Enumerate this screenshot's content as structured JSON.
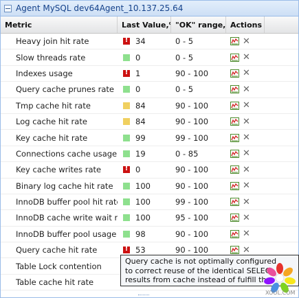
{
  "panel": {
    "title": "Agent MySQL dev64Agent_10.137.25.64"
  },
  "columns": {
    "metric": "Metric",
    "last_value": "Last Value,%",
    "ok_range": "\"OK\" range,%",
    "actions": "Actions"
  },
  "rows": [
    {
      "metric": "Heavy join hit rate",
      "status": "critical",
      "value": "34",
      "range": "0 - 5"
    },
    {
      "metric": "Slow threads rate",
      "status": "ok",
      "value": "0",
      "range": "0 - 5"
    },
    {
      "metric": "Indexes usage",
      "status": "critical",
      "value": "1",
      "range": "90 - 100"
    },
    {
      "metric": "Query cache prunes rate",
      "status": "ok",
      "value": "0",
      "range": "0 - 5"
    },
    {
      "metric": "Tmp cache hit rate",
      "status": "warning",
      "value": "84",
      "range": "90 - 100"
    },
    {
      "metric": "Log cache hit rate",
      "status": "warning",
      "value": "84",
      "range": "90 - 100"
    },
    {
      "metric": "Key cache hit rate",
      "status": "ok",
      "value": "99",
      "range": "99 - 100"
    },
    {
      "metric": "Connections cache usage",
      "status": "ok",
      "value": "19",
      "range": "0 - 85"
    },
    {
      "metric": "Key cache writes rate",
      "status": "critical",
      "value": "0",
      "range": "90 - 100"
    },
    {
      "metric": "Binary log cache hit rate",
      "status": "ok",
      "value": "100",
      "range": "90 - 100"
    },
    {
      "metric": "InnoDB buffer pool hit rate",
      "status": "ok",
      "value": "100",
      "range": "99 - 100"
    },
    {
      "metric": "InnoDB cache write wait rate",
      "status": "ok",
      "value": "100",
      "range": "95 - 100"
    },
    {
      "metric": "InnoDB buffer pool usage",
      "status": "ok",
      "value": "98",
      "range": "90 - 100"
    },
    {
      "metric": "Query cache hit rate",
      "status": "critical",
      "value": "53",
      "range": "90 - 100"
    },
    {
      "metric": "Table Lock contention",
      "status": "",
      "value": "",
      "range": ""
    },
    {
      "metric": "Table cache hit rate",
      "status": "",
      "value": "",
      "range": ""
    }
  ],
  "tooltip": {
    "lines": [
      "Query cache is not optimally configured",
      "to correct reuse of the identical SELEC",
      "results from cache instead of fulfill th"
    ]
  },
  "watermark": {
    "text": "XOOL.COM"
  },
  "colors": {
    "ok": "#8ee08e",
    "warning": "#f0d060",
    "critical": "#cc1111",
    "header_text": "#15428b"
  }
}
